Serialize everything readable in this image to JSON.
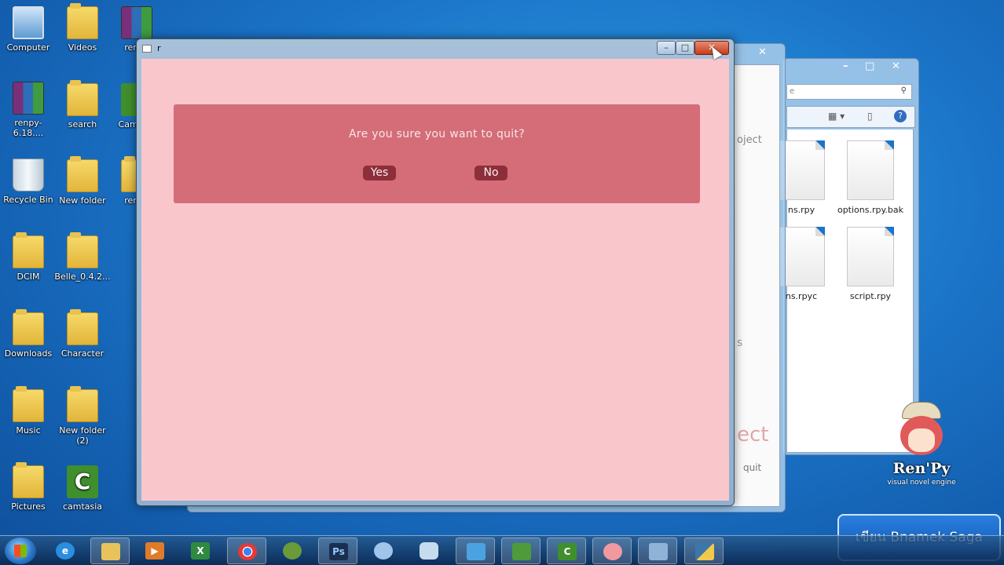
{
  "desktop": {
    "icons": [
      {
        "label": "Computer",
        "kind": "computer"
      },
      {
        "label": "renpy-6.18....",
        "kind": "rar"
      },
      {
        "label": "Recycle Bin",
        "kind": "bin"
      },
      {
        "label": "DCIM",
        "kind": "folder"
      },
      {
        "label": "Downloads",
        "kind": "folder"
      },
      {
        "label": "Music",
        "kind": "folder"
      },
      {
        "label": "Pictures",
        "kind": "folder"
      },
      {
        "label": "Videos",
        "kind": "folder"
      },
      {
        "label": "search",
        "kind": "folder"
      },
      {
        "label": "New folder",
        "kind": "folder"
      },
      {
        "label": "Belle_0.4.2...",
        "kind": "folder"
      },
      {
        "label": "Character",
        "kind": "folder"
      },
      {
        "label": "New folder (2)",
        "kind": "folder"
      },
      {
        "label": "camtasia",
        "kind": "camtasia"
      },
      {
        "label": "renpy",
        "kind": "rar"
      },
      {
        "label": "Cam Stu",
        "kind": "camtasia"
      },
      {
        "label": "renpy",
        "kind": "folder"
      }
    ]
  },
  "game_window": {
    "title": "r",
    "dialog": {
      "message": "Are you sure you want to quit?",
      "yes_label": "Yes",
      "no_label": "No"
    },
    "buttons": {
      "minimize": "–",
      "maximize": "□",
      "close": "✕"
    }
  },
  "launcher_window": {
    "partial_texts": [
      "oject",
      "s",
      "ect",
      "quit"
    ],
    "close": "✕"
  },
  "explorer_window": {
    "search_hint": "e",
    "files": [
      "ns.rpy",
      "options.rpy.bak",
      "ns.rpyc",
      "script.rpy"
    ],
    "buttons": {
      "minimize": "–",
      "maximize": "□",
      "close": "✕"
    }
  },
  "logo": {
    "text": "Ren'Py",
    "subtitle": "visual novel engine"
  },
  "banner": {
    "text": "เขียน Bnamek Saga"
  },
  "taskbar": {
    "apps": [
      "ie-icon",
      "explorer-icon",
      "media-player-icon",
      "excel-icon",
      "chrome-icon",
      "app-icon",
      "photoshop-icon",
      "chat-icon",
      "game-icon",
      "network-icon",
      "tool-icon",
      "camtasia-icon",
      "renpy-icon",
      "settings-icon",
      "python-icon"
    ],
    "ps_label": "Ps"
  },
  "colors": {
    "game_bg": "#f9c6cc",
    "dialog_bg": "#d46d78",
    "button_bg": "#8c2f3a"
  }
}
